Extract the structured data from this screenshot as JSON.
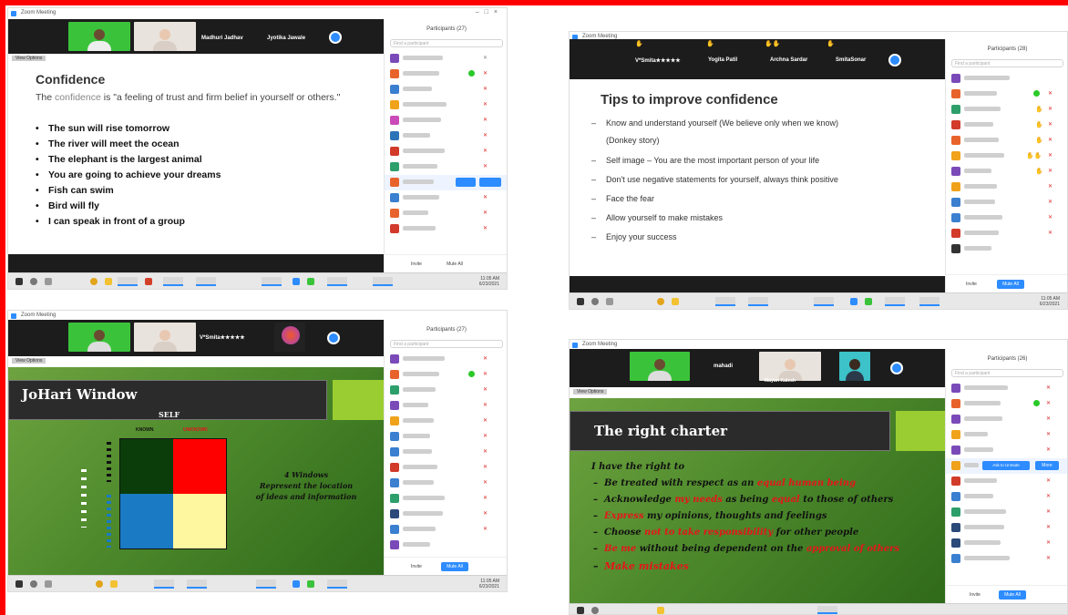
{
  "panels": {
    "p1": {
      "window_title": "Zoom Meeting",
      "participant_names": [
        "Madhuri Jadhav",
        "Jyotika Jawale"
      ],
      "view_label": "View Options",
      "sidebar_title": "Participants (27)",
      "sidebar_search": "Find a participant",
      "sidebar_buttons": [
        "Invite",
        "Mute All"
      ],
      "slide": {
        "title": "Confidence",
        "intro_prefix": "The ",
        "intro_highlight": "confidence",
        "intro_rest": " is \"a feeling of trust and firm belief in yourself or others.\"",
        "bullets": [
          "The sun will rise tomorrow",
          "The river will meet the ocean",
          "The elephant is the largest animal",
          "You are going to achieve your dreams",
          "Fish can swim",
          "Bird will fly",
          "I can speak in front of a group"
        ]
      },
      "bullet_glyph": "•"
    },
    "p2": {
      "window_title": "Zoom Meeting",
      "participant_names": [
        "V*Smita★★★★★",
        "Yogita Patil",
        "Archna Sardar",
        "SmitaSonar"
      ],
      "sidebar_title": "Participants (28)",
      "sidebar_search": "Find a participant",
      "sidebar_buttons": [
        "Invite",
        "Mute All"
      ],
      "slide": {
        "title": "Tips to improve confidence",
        "bullets": [
          "Know and understand yourself (We believe only when we know)",
          "(Donkey story)",
          "Self image – You are the most important person of your life",
          "Don't use negative statements for yourself, always think positive",
          "Face the fear",
          "Allow yourself to make mistakes",
          "Enjoy your success"
        ]
      },
      "dash_glyph": "–"
    },
    "p3": {
      "window_title": "Zoom Meeting",
      "participant_names": [
        "V*Smita★★★★★"
      ],
      "view_label": "View Options",
      "sidebar_title": "Participants (27)",
      "sidebar_search": "Find a participant",
      "sidebar_buttons": [
        "Invite",
        "Mute All"
      ],
      "slide": {
        "title": "JoHari Window",
        "self_label": "SELF",
        "known_label": "KNOWN",
        "unknown_label": "UNKNOWN",
        "note_title": "4 Windows",
        "note_line1": "Represent the location",
        "note_line2": "of ideas and information"
      },
      "quadrant_colors": [
        "#0b3d0b",
        "#ff0000",
        "#1a7ac4",
        "#fff7a0"
      ]
    },
    "p4": {
      "window_title": "Zoom Meeting",
      "participant_names": [
        "mahadi",
        "Mayuri Kalesh"
      ],
      "view_label": "View Options",
      "sidebar_title": "Participants (26)",
      "sidebar_search": "Find a participant",
      "sidebar_buttons": [
        "Invite",
        "Mute All"
      ],
      "sidebar_row_buttons": [
        "Ask to Unmute",
        "More"
      ],
      "slide": {
        "title": "The right charter",
        "intro": "I have the right to",
        "l1_a": "Be treated with respect as an ",
        "l1_b": "equal human being",
        "l2_a": "Acknowledge ",
        "l2_b": "my needs",
        "l2_c": " as being ",
        "l2_d": "equal",
        "l2_e": " to those of others",
        "l3_a": "Express",
        "l3_b": " my opinions, thoughts and feelings",
        "l4_a": "Choose ",
        "l4_b": "not to take responsibility",
        "l4_c": " for other people",
        "l5_a": "Be me",
        "l5_b": " without being dependent on the ",
        "l5_c": "approval of others",
        "l6": "Make mistakes"
      },
      "dash_glyph": "–"
    }
  },
  "taskbar_clock": [
    "11:05 AM",
    "6/23/2021"
  ],
  "colors": {
    "border": "#ff0000",
    "zoom_blue": "#2d8cff",
    "slide_green": "#4e8a2c",
    "highlight_red": "#e4161a"
  }
}
